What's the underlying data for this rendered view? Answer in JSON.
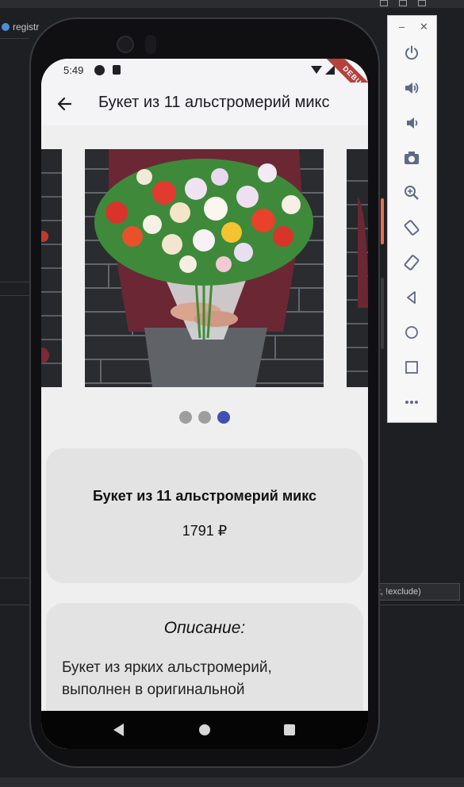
{
  "ide": {
    "tab_label": "registr",
    "filter_field_text": "t, !exclude)"
  },
  "status_bar": {
    "time": "5:49",
    "debug_banner": "DEBUG"
  },
  "app_bar": {
    "title": "Букет из 11 альстромерий микс"
  },
  "carousel": {
    "slide_count": 3,
    "active_index": 2,
    "dot_inactive_color": "#9e9e9e",
    "dot_active_color": "#3f51b5"
  },
  "product": {
    "name": "Букет из 11 альстромерий микс",
    "price": "1791 ₽"
  },
  "description": {
    "heading": "Описание:",
    "text": "Букет из ярких альстромерий, выполнен в оригинальной"
  },
  "emulator_toolbar": {
    "buttons": [
      "power-icon",
      "volume-up-icon",
      "volume-down-icon",
      "camera-icon",
      "zoom-icon",
      "rotate-left-icon",
      "rotate-right-icon",
      "back-icon",
      "home-icon",
      "overview-icon",
      "more-icon"
    ]
  },
  "colors": {
    "accent": "#3f51b5",
    "card_background": "#e3e3e3",
    "screen_background": "#efefef",
    "debug_ribbon": "#b4413c"
  }
}
